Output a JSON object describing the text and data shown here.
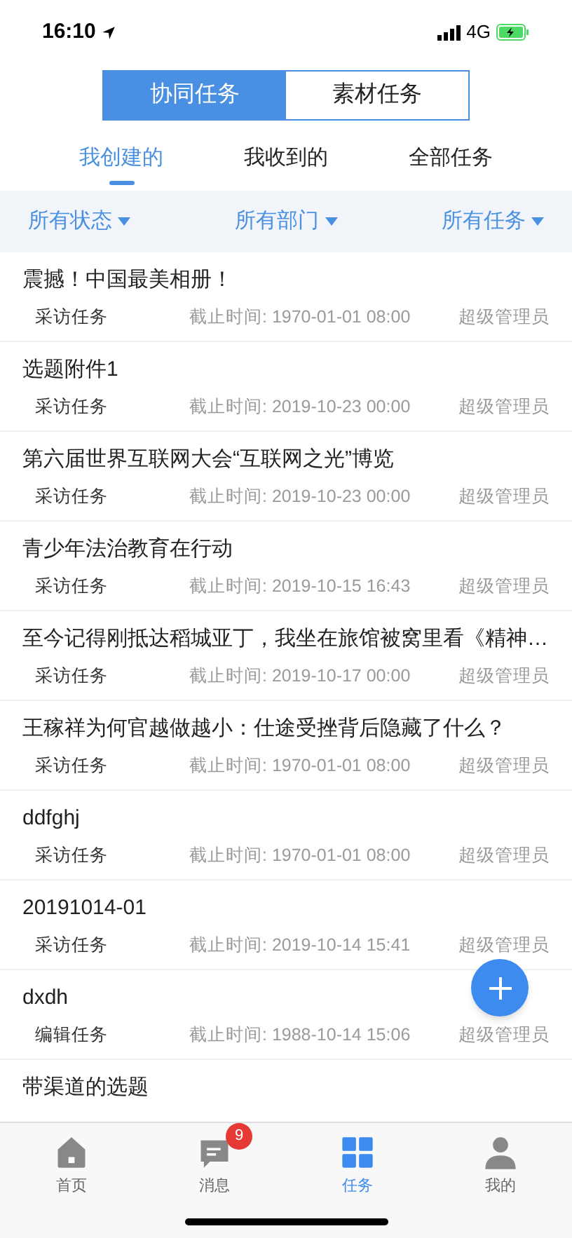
{
  "status_bar": {
    "time": "16:10",
    "network": "4G"
  },
  "segments": [
    {
      "label": "协同任务",
      "selected": true
    },
    {
      "label": "素材任务",
      "selected": false
    }
  ],
  "tabs": [
    {
      "label": "我创建的",
      "selected": true
    },
    {
      "label": "我收到的",
      "selected": false
    },
    {
      "label": "全部任务",
      "selected": false
    }
  ],
  "filters": [
    "所有状态",
    "所有部门",
    "所有任务"
  ],
  "tasks": [
    {
      "title": "震撼！中国最美相册！",
      "type": "采访任务",
      "deadline": "截止时间: 1970-01-01 08:00",
      "owner": "超级管理员"
    },
    {
      "title": "选题附件1",
      "type": "采访任务",
      "deadline": "截止时间: 2019-10-23 00:00",
      "owner": "超级管理员"
    },
    {
      "title": "第六届世界互联网大会“互联网之光”博览",
      "type": "采访任务",
      "deadline": "截止时间: 2019-10-23 00:00",
      "owner": "超级管理员"
    },
    {
      "title": "青少年法治教育在行动",
      "type": "采访任务",
      "deadline": "截止时间: 2019-10-15 16:43",
      "owner": "超级管理员"
    },
    {
      "title": "至今记得刚抵达稻城亚丁，我坐在旅馆被窝里看《精神…",
      "type": "采访任务",
      "deadline": "截止时间: 2019-10-17 00:00",
      "owner": "超级管理员"
    },
    {
      "title": "王稼祥为何官越做越小：仕途受挫背后隐藏了什么？",
      "type": "采访任务",
      "deadline": "截止时间: 1970-01-01 08:00",
      "owner": "超级管理员"
    },
    {
      "title": "ddfghj",
      "type": "采访任务",
      "deadline": "截止时间: 1970-01-01 08:00",
      "owner": "超级管理员"
    },
    {
      "title": "20191014-01",
      "type": "采访任务",
      "deadline": "截止时间: 2019-10-14 15:41",
      "owner": "超级管理员"
    },
    {
      "title": "dxdh",
      "type": "编辑任务",
      "deadline": "截止时间: 1988-10-14 15:06",
      "owner": "超级管理员"
    },
    {
      "title": "带渠道的选题"
    }
  ],
  "nav": [
    {
      "label": "首页",
      "kind": "home",
      "selected": false
    },
    {
      "label": "消息",
      "kind": "message",
      "selected": false,
      "badge": "9"
    },
    {
      "label": "任务",
      "kind": "grid",
      "selected": true
    },
    {
      "label": "我的",
      "kind": "person",
      "selected": false
    }
  ]
}
